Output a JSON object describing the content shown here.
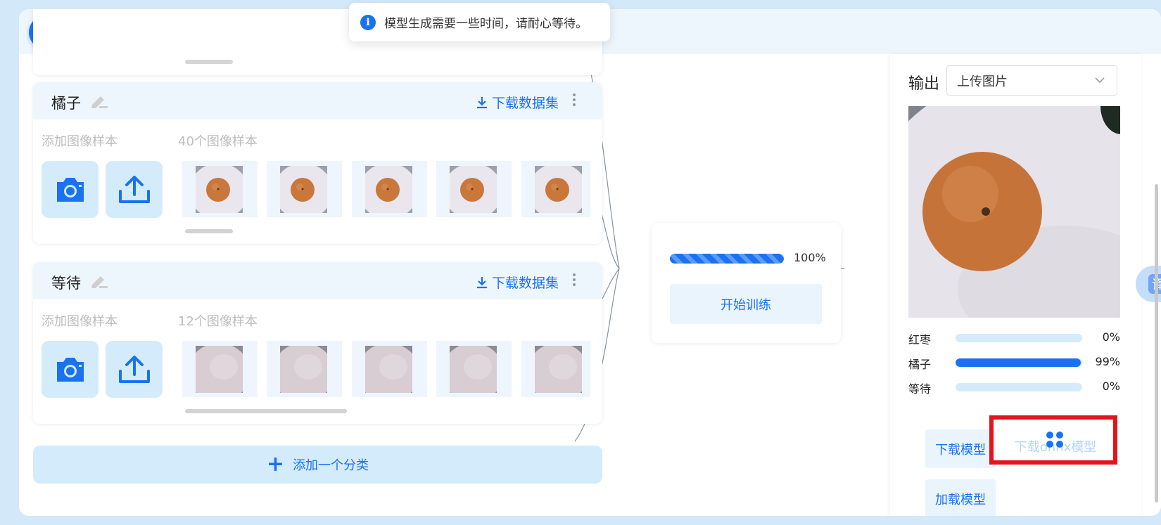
{
  "toast": {
    "message": "模型生成需要一些时间，请耐心等待。"
  },
  "classes": [
    {
      "name": "橘子",
      "add_label": "添加图像样本",
      "count_label": "40个图像样本",
      "download_label": "下载数据集",
      "thumb_type": "orange"
    },
    {
      "name": "等待",
      "add_label": "添加图像样本",
      "count_label": "12个图像样本",
      "download_label": "下载数据集",
      "thumb_type": "empty"
    }
  ],
  "add_class": {
    "label": "添加一个分类"
  },
  "training": {
    "progress": 100,
    "progress_label": "100%",
    "button": "开始训练"
  },
  "output": {
    "label": "输出",
    "select_value": "上传图片",
    "results": [
      {
        "name": "红枣",
        "value": 0,
        "pct": "0%"
      },
      {
        "name": "橘子",
        "value": 99,
        "pct": "99%"
      },
      {
        "name": "等待",
        "value": 0,
        "pct": "0%"
      }
    ],
    "download_model": "下载模型",
    "download_onnx": "下载onnx模型",
    "load_model": "加载模型"
  },
  "side_widget": {
    "text": "译"
  },
  "colors": {
    "accent": "#1a72f0",
    "light": "#d4ebfb",
    "highlight": "#e3141b"
  }
}
